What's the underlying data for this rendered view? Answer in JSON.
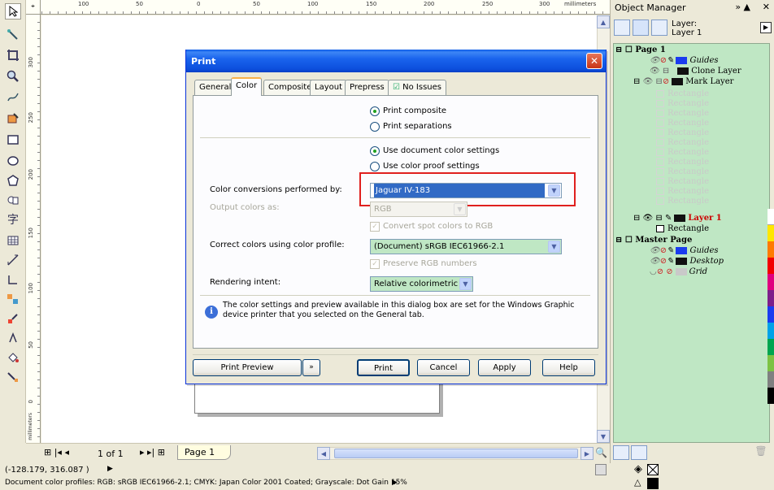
{
  "ruler": {
    "h_ticks": [
      "100",
      "50",
      "0",
      "50",
      "100",
      "150",
      "200",
      "250",
      "300",
      "millimeters"
    ],
    "v_ticks": [
      "300",
      "250",
      "200",
      "150",
      "100",
      "50",
      "0",
      "millimeters"
    ]
  },
  "docker": {
    "title": "Object Manager",
    "layer_label": "Layer:",
    "layer_value": "Layer 1",
    "tree": {
      "page1": "Page 1",
      "guides": "Guides",
      "clone_layer": "Clone Layer",
      "mark_layer": "Mark Layer",
      "ghost_items": [
        "Rectangle",
        "Rectangle",
        "Rectangle",
        "Rectangle",
        "Rectangle",
        "Rectangle",
        "Rectangle",
        "Rectangle",
        "Rectangle",
        "Rectangle",
        "Rectangle",
        "Rectangle"
      ],
      "layer1": "Layer 1",
      "rectangle": "Rectangle",
      "master_page": "Master Page",
      "master_guides": "Guides",
      "desktop": "Desktop",
      "grid": "Grid"
    }
  },
  "pagebar": {
    "page_count": "1 of 1",
    "page_tab": "Page 1"
  },
  "status": {
    "coords": "(-128.179, 316.087 )",
    "profiles": "Document color profiles: RGB: sRGB IEC61966-2.1; CMYK: Japan Color 2001 Coated; Grayscale: Dot Gain 15%"
  },
  "dialog": {
    "title": "Print",
    "tabs": [
      "General",
      "Color",
      "Composite",
      "Layout",
      "Prepress",
      "No Issues"
    ],
    "print_composite": "Print composite",
    "print_separations": "Print separations",
    "use_document_settings": "Use document color settings",
    "use_proof_settings": "Use color proof settings",
    "conversions_label": "Color conversions performed by:",
    "conversions_value": "Jaguar IV-183",
    "output_label": "Output colors as:",
    "output_value": "RGB",
    "convert_spot": "Convert spot colors to RGB",
    "correct_label": "Correct colors using color profile:",
    "correct_value": "(Document) sRGB IEC61966-2.1",
    "preserve_rgb": "Preserve RGB numbers",
    "intent_label": "Rendering intent:",
    "intent_value": "Relative colorimetric",
    "info_text": "The color settings and preview available in this dialog box are set for the Windows Graphic device printer that you selected on the General tab.",
    "buttons": {
      "preview": "Print Preview",
      "print": "Print",
      "cancel": "Cancel",
      "apply": "Apply",
      "help": "Help"
    }
  },
  "colors": {
    "title_blue": "#0a4fdd",
    "highlight_red": "#e0201e",
    "selection_blue": "#316ac5",
    "docker_green": "#bfe7c4"
  }
}
